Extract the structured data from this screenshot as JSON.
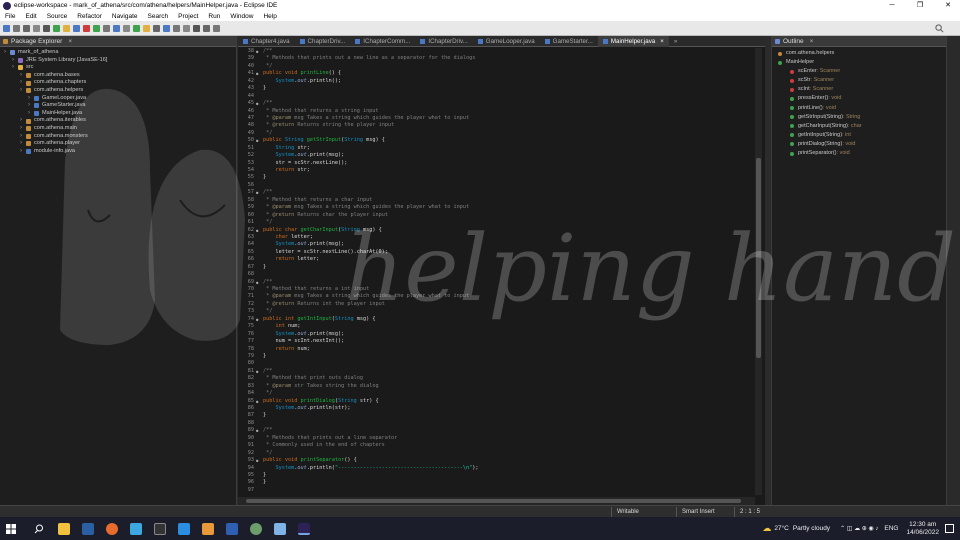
{
  "window": {
    "title": "eclipse-workspace - mark_of_athena/src/com/athena/helpers/MainHelper.java - Eclipse IDE",
    "minimize": "─",
    "maximize": "❐",
    "close": "✕"
  },
  "menu": [
    "File",
    "Edit",
    "Source",
    "Refactor",
    "Navigate",
    "Search",
    "Project",
    "Run",
    "Window",
    "Help"
  ],
  "package_explorer": {
    "title": "Package Explorer",
    "nodes": [
      {
        "label": "mark_of_athena",
        "indent": 0,
        "color": "#6a8bd0"
      },
      {
        "label": "JRE System Library [JavaSE-16]",
        "indent": 1,
        "color": "#8a6bbd"
      },
      {
        "label": "src",
        "indent": 1,
        "color": "#e0b040"
      },
      {
        "label": "com.athena.bases",
        "indent": 2,
        "color": "#c28b3a"
      },
      {
        "label": "com.athena.chapters",
        "indent": 2,
        "color": "#c28b3a"
      },
      {
        "label": "com.athena.helpers",
        "indent": 2,
        "color": "#c28b3a"
      },
      {
        "label": "GameLooper.java",
        "indent": 3,
        "color": "#4a78c2"
      },
      {
        "label": "GameStarter.java",
        "indent": 3,
        "color": "#4a78c2"
      },
      {
        "label": "MainHelper.java",
        "indent": 3,
        "color": "#4a78c2"
      },
      {
        "label": "com.athena.iterables",
        "indent": 2,
        "color": "#c28b3a"
      },
      {
        "label": "com.athena.main",
        "indent": 2,
        "color": "#c28b3a"
      },
      {
        "label": "com.athena.monsters",
        "indent": 2,
        "color": "#c28b3a"
      },
      {
        "label": "com.athena.player",
        "indent": 2,
        "color": "#c28b3a"
      },
      {
        "label": "module-info.java",
        "indent": 2,
        "color": "#4a78c2"
      }
    ]
  },
  "editor_tabs": [
    {
      "label": "Chapter4.java",
      "active": false
    },
    {
      "label": "ChapterDriv...",
      "active": false
    },
    {
      "label": "IChapterComm...",
      "active": false
    },
    {
      "label": "IChapterDriv...",
      "active": false
    },
    {
      "label": "GameLooper.java",
      "active": false
    },
    {
      "label": "GameStarter...",
      "active": false
    },
    {
      "label": "MainHelper.java",
      "active": true
    }
  ],
  "editor_tabs_overflow": "»",
  "code_lines": [
    {
      "n": "38",
      "m": true,
      "h": "<span class='cm'>/**</span>"
    },
    {
      "n": "39",
      "m": false,
      "h": "<span class='cm'> * Methods that prints out a new line as a separator for the dialogs</span>"
    },
    {
      "n": "40",
      "m": false,
      "h": "<span class='cm'> */</span>"
    },
    {
      "n": "41",
      "m": true,
      "h": "<span class='kw'>public void</span> <span class='fn'>printLine</span>() {"
    },
    {
      "n": "42",
      "m": false,
      "h": "    <span class='ty'>System</span>.<span class='it'>out</span>.println();"
    },
    {
      "n": "43",
      "m": false,
      "h": "}"
    },
    {
      "n": "44",
      "m": false,
      "h": ""
    },
    {
      "n": "45",
      "m": true,
      "h": "<span class='cm'>/**</span>"
    },
    {
      "n": "46",
      "m": false,
      "h": "<span class='cm'> * Method that returns a string input</span>"
    },
    {
      "n": "47",
      "m": false,
      "h": "<span class='cm'> * </span><span class='tg'>@param</span><span class='cm'> msg Takes a string which guides the player what to input</span>"
    },
    {
      "n": "48",
      "m": false,
      "h": "<span class='cm'> * </span><span class='tg'>@return</span><span class='cm'> Returns string the player input</span>"
    },
    {
      "n": "49",
      "m": false,
      "h": "<span class='cm'> */</span>"
    },
    {
      "n": "50",
      "m": true,
      "h": "<span class='kw'>public</span> <span class='ty'>String</span> <span class='fn'>getStrInput</span>(<span class='ty'>String</span> msg) {"
    },
    {
      "n": "51",
      "m": false,
      "h": "    <span class='ty'>String</span> str;"
    },
    {
      "n": "52",
      "m": false,
      "h": "    <span class='ty'>System</span>.<span class='it'>out</span>.print(msg);"
    },
    {
      "n": "53",
      "m": false,
      "h": "    str = scStr.nextLine();"
    },
    {
      "n": "54",
      "m": false,
      "h": "    <span class='kw'>return</span> str;"
    },
    {
      "n": "55",
      "m": false,
      "h": "}"
    },
    {
      "n": "56",
      "m": false,
      "h": ""
    },
    {
      "n": "57",
      "m": true,
      "h": "<span class='cm'>/**</span>"
    },
    {
      "n": "58",
      "m": false,
      "h": "<span class='cm'> * Method that returns a char input</span>"
    },
    {
      "n": "59",
      "m": false,
      "h": "<span class='cm'> * </span><span class='tg'>@param</span><span class='cm'> msg Takes a string which guides the player what to input</span>"
    },
    {
      "n": "60",
      "m": false,
      "h": "<span class='cm'> * </span><span class='tg'>@return</span><span class='cm'> Returns char the player input</span>"
    },
    {
      "n": "61",
      "m": false,
      "h": "<span class='cm'> */</span>"
    },
    {
      "n": "62",
      "m": true,
      "h": "<span class='kw'>public char</span> <span class='fn'>getCharInput</span>(<span class='ty'>String</span> msg) {"
    },
    {
      "n": "63",
      "m": false,
      "h": "    <span class='kw'>char</span> letter;"
    },
    {
      "n": "64",
      "m": false,
      "h": "    <span class='ty'>System</span>.<span class='it'>out</span>.print(msg);"
    },
    {
      "n": "65",
      "m": false,
      "h": "    letter = scStr.nextLine().charAt(0);"
    },
    {
      "n": "66",
      "m": false,
      "h": "    <span class='kw'>return</span> letter;"
    },
    {
      "n": "67",
      "m": false,
      "h": "}"
    },
    {
      "n": "68",
      "m": false,
      "h": ""
    },
    {
      "n": "69",
      "m": true,
      "h": "<span class='cm'>/**</span>"
    },
    {
      "n": "70",
      "m": false,
      "h": "<span class='cm'> * Method that returns a int input</span>"
    },
    {
      "n": "71",
      "m": false,
      "h": "<span class='cm'> * </span><span class='tg'>@param</span><span class='cm'> msg Takes a string which guides the player what to input</span>"
    },
    {
      "n": "72",
      "m": false,
      "h": "<span class='cm'> * </span><span class='tg'>@return</span><span class='cm'> Returns int the player input</span>"
    },
    {
      "n": "73",
      "m": false,
      "h": "<span class='cm'> */</span>"
    },
    {
      "n": "74",
      "m": true,
      "h": "<span class='kw'>public int</span> <span class='fn'>getIntInput</span>(<span class='ty'>String</span> msg) {"
    },
    {
      "n": "75",
      "m": false,
      "h": "    <span class='kw'>int</span> num;"
    },
    {
      "n": "76",
      "m": false,
      "h": "    <span class='ty'>System</span>.<span class='it'>out</span>.print(msg);"
    },
    {
      "n": "77",
      "m": false,
      "h": "    num = scInt.nextInt();"
    },
    {
      "n": "78",
      "m": false,
      "h": "    <span class='kw'>return</span> num;"
    },
    {
      "n": "79",
      "m": false,
      "h": "}"
    },
    {
      "n": "80",
      "m": false,
      "h": ""
    },
    {
      "n": "81",
      "m": true,
      "h": "<span class='cm'>/**</span>"
    },
    {
      "n": "82",
      "m": false,
      "h": "<span class='cm'> * Method that print outs dialog</span>"
    },
    {
      "n": "83",
      "m": false,
      "h": "<span class='cm'> * </span><span class='tg'>@param</span><span class='cm'> str Takes string the dialog</span>"
    },
    {
      "n": "84",
      "m": false,
      "h": "<span class='cm'> */</span>"
    },
    {
      "n": "85",
      "m": true,
      "h": "<span class='kw'>public void</span> <span class='fn'>printDialog</span>(<span class='ty'>String</span> str) {"
    },
    {
      "n": "86",
      "m": false,
      "h": "    <span class='ty'>System</span>.<span class='it'>out</span>.println(str);"
    },
    {
      "n": "87",
      "m": false,
      "h": "}"
    },
    {
      "n": "88",
      "m": false,
      "h": ""
    },
    {
      "n": "89",
      "m": true,
      "h": "<span class='cm'>/**</span>"
    },
    {
      "n": "90",
      "m": false,
      "h": "<span class='cm'> * Methods that prints out a line separator</span>"
    },
    {
      "n": "91",
      "m": false,
      "h": "<span class='cm'> * Commonly used in the end of chapters</span>"
    },
    {
      "n": "92",
      "m": false,
      "h": "<span class='cm'> */</span>"
    },
    {
      "n": "93",
      "m": true,
      "h": "<span class='kw'>public void</span> <span class='fn'>printSeparator</span>() {"
    },
    {
      "n": "94",
      "m": false,
      "h": "    <span class='ty'>System</span>.<span class='it'>out</span>.println(<span class='st'>\"----------------------------------------\\n\"</span>);"
    },
    {
      "n": "95",
      "m": false,
      "h": "}"
    },
    {
      "n": "96",
      "m": false,
      "h": "}"
    },
    {
      "n": "97",
      "m": false,
      "h": ""
    }
  ],
  "outline": {
    "title": "Outline",
    "nodes": [
      {
        "name": "com.athena.helpers",
        "type": "",
        "indent": 0,
        "color": "#c28b3a"
      },
      {
        "name": "MainHelper",
        "type": "",
        "indent": 0,
        "color": "#3fa34d"
      },
      {
        "name": "scEnter",
        "type": " : Scanner",
        "indent": 1,
        "color": "#d03c3c"
      },
      {
        "name": "scStr",
        "type": " : Scanner",
        "indent": 1,
        "color": "#d03c3c"
      },
      {
        "name": "scInt",
        "type": " : Scanner",
        "indent": 1,
        "color": "#d03c3c"
      },
      {
        "name": "pressEnter()",
        "type": " : void",
        "indent": 1,
        "color": "#3fa34d"
      },
      {
        "name": "printLine()",
        "type": " : void",
        "indent": 1,
        "color": "#3fa34d"
      },
      {
        "name": "getStrInput(String)",
        "type": " : String",
        "indent": 1,
        "color": "#3fa34d"
      },
      {
        "name": "getCharInput(String)",
        "type": " : char",
        "indent": 1,
        "color": "#3fa34d"
      },
      {
        "name": "getIntInput(String)",
        "type": " : int",
        "indent": 1,
        "color": "#3fa34d"
      },
      {
        "name": "printDialog(String)",
        "type": " : void",
        "indent": 1,
        "color": "#3fa34d"
      },
      {
        "name": "printSeparator()",
        "type": " : void",
        "indent": 1,
        "color": "#3fa34d"
      }
    ]
  },
  "status": {
    "mode": "Writable",
    "insert": "Smart Insert",
    "position": "2 : 1 : 5"
  },
  "taskbar": {
    "temperature": "27°C",
    "weather": "Partly cloudy",
    "lang": "ENG",
    "time": "12:30 am",
    "date": "14/06/2022"
  },
  "watermark": "helping hand",
  "colors": {
    "accent": "#4a78c2",
    "background": "#1a1a1a"
  }
}
